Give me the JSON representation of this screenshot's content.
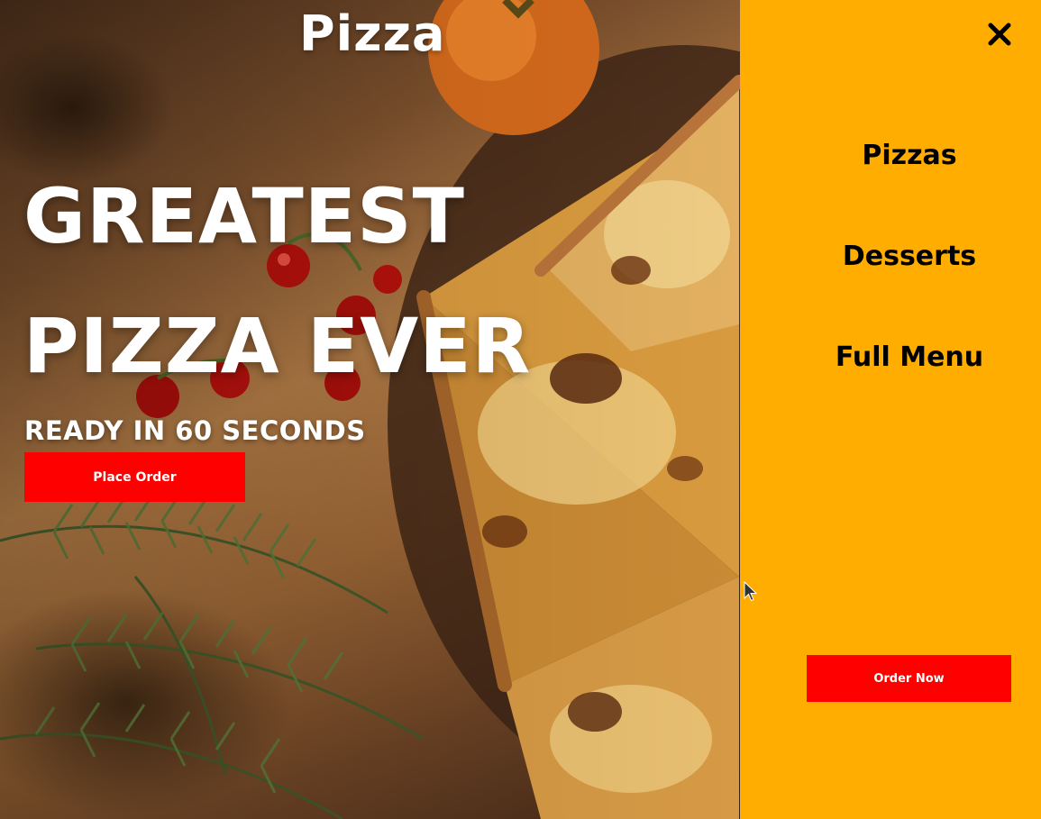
{
  "brand": {
    "logo_text": "Pizza"
  },
  "hero": {
    "headline_line1": "GREATEST",
    "headline_line2": "PIZZA EVER",
    "subheadline": "READY IN 60 SECONDS",
    "cta_label": "Place Order"
  },
  "menu": {
    "close_icon": "close-icon",
    "items": [
      {
        "label": "Pizzas"
      },
      {
        "label": "Desserts"
      },
      {
        "label": "Full Menu"
      }
    ],
    "cta_label": "Order Now"
  },
  "colors": {
    "menu_background": "#ffad00",
    "button_red": "#ff0000",
    "text_white": "#ffffff",
    "text_black": "#000000"
  }
}
